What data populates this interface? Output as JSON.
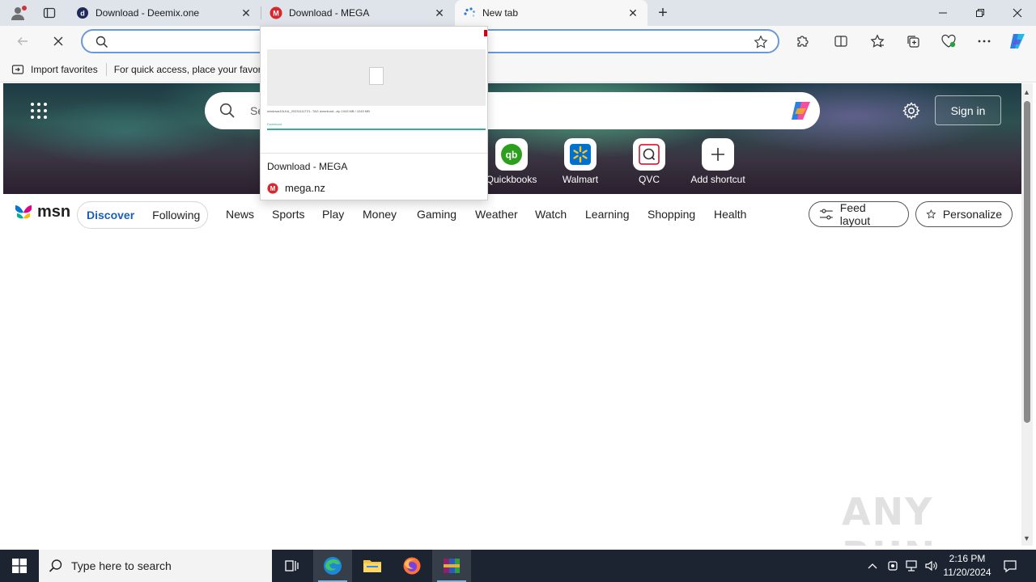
{
  "tabs": [
    {
      "title": "Download - Deemix.one",
      "close": "✕"
    },
    {
      "title": "Download - MEGA",
      "close": "✕"
    },
    {
      "title": "New tab",
      "close": "✕"
    }
  ],
  "newtab_symbol": "+",
  "addressbar": {
    "value": "",
    "placeholder": ""
  },
  "favorites_bar": {
    "import_label": "Import favorites",
    "hint": "For quick access, place your favori"
  },
  "hero": {
    "search_placeholder": "Se",
    "signin_label": "Sign in",
    "shortcuts": [
      {
        "label": "Quickbooks",
        "icon": "quickbooks-icon"
      },
      {
        "label": "Walmart",
        "icon": "walmart-icon"
      },
      {
        "label": "QVC",
        "icon": "qvc-icon"
      },
      {
        "label": "Add shortcut",
        "icon": "plus-icon"
      }
    ]
  },
  "msn": {
    "logo_text": "msn",
    "pills": [
      "Discover",
      "Following"
    ],
    "nav": [
      "News",
      "Sports",
      "Play",
      "Money",
      "Gaming",
      "Weather",
      "Watch",
      "Learning",
      "Shopping",
      "Health"
    ],
    "feed_layout": "Feed layout",
    "personalize": "Personalize"
  },
  "tab_preview": {
    "title": "Download - MEGA",
    "url": "mega.nz",
    "thumb_line": "windows10LKA_20231111TZ1..TAG download...zip   1043 MB / 1043 MB",
    "thumb_status": "Download"
  },
  "watermark": "ANY RUN",
  "taskbar": {
    "search_placeholder": "Type here to search",
    "time": "2:16 PM",
    "date": "11/20/2024"
  },
  "colors": {
    "accent": "#1a5fb4",
    "mega_red": "#d9272e",
    "taskbar": "#1b2430"
  }
}
